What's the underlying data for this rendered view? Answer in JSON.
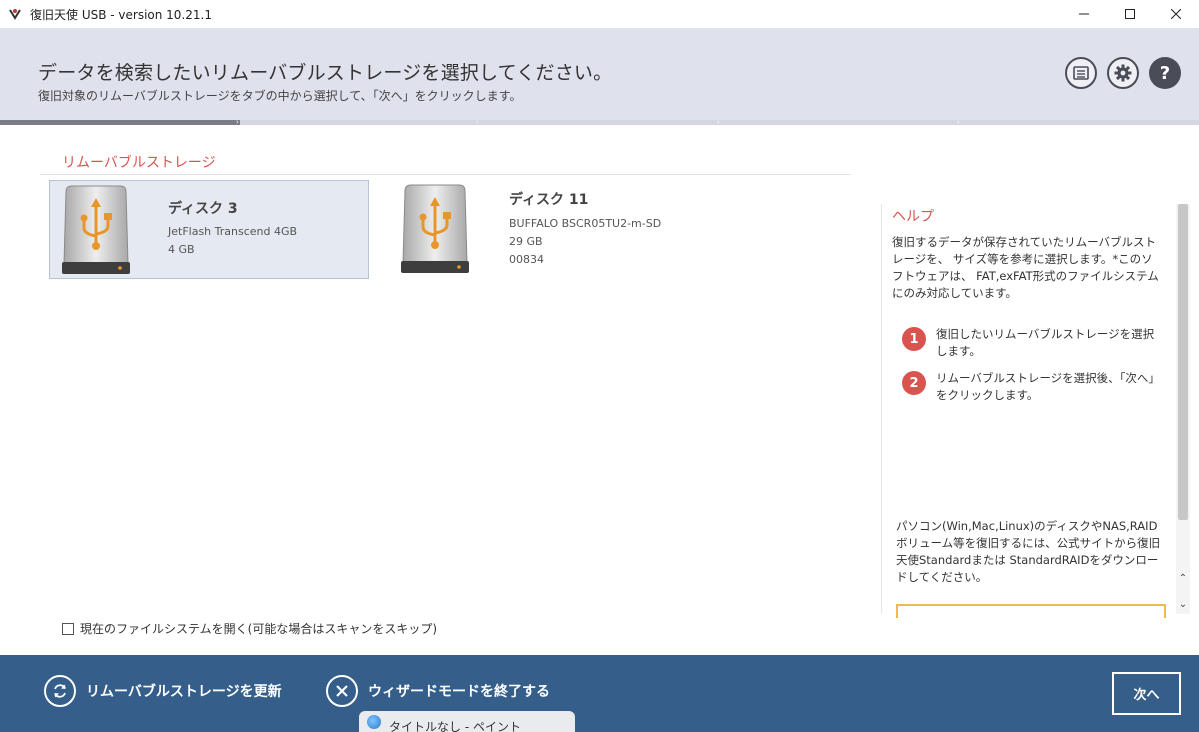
{
  "window": {
    "title": "復旧天使 USB - version 10.21.1"
  },
  "header": {
    "heading": "データを検索したいリムーバブルストレージを選択してください。",
    "subheading": "復旧対象のリムーバブルストレージをタブの中から選択して、「次へ」をクリックします。",
    "icons": [
      "log-icon",
      "gear-icon",
      "help-icon"
    ],
    "help_glyph": "?"
  },
  "progress": {
    "step": 1,
    "total_steps": 5
  },
  "storage": {
    "section_title": "リムーバブルストレージ",
    "disks": [
      {
        "name": "ディスク 3",
        "lines": [
          "JetFlash Transcend 4GB",
          "4 GB"
        ],
        "selected": true
      },
      {
        "name": "ディスク 11",
        "lines": [
          "BUFFALO BSCR05TU2-m-SD",
          "29 GB",
          "00834"
        ],
        "selected": false
      }
    ]
  },
  "options": {
    "open_fs_label": "現在のファイルシステムを開く(可能な場合はスキャンをスキップ)",
    "open_fs_checked": false
  },
  "help": {
    "title": "ヘルプ",
    "text": "復旧するデータが保存されていたリムーバブルストレージを、 サイズ等を参考に選択します。*このソフトウェアは、 FAT,exFAT形式のファイルシステムにのみ対応しています。",
    "steps": [
      {
        "num": "1",
        "text": "復旧したいリムーバブルストレージを選択します。"
      },
      {
        "num": "2",
        "text": "リムーバブルストレージを選択後、「次へ」をクリックします。"
      }
    ],
    "promo": "パソコン(Win,Mac,Linux)のディスクやNAS,RAIDボリューム等を復旧するには、公式サイトから復旧天使Standardまたは StandardRAIDをダウンロードしてください。"
  },
  "footer": {
    "refresh_label": "リムーバブルストレージを更新",
    "exit_label": "ウィザードモードを終了する",
    "next_label": "次へ"
  },
  "taskbar": {
    "thumbnail_label": "タイトルなし - ペイント"
  },
  "colors": {
    "accent_red": "#d9534f",
    "footer_blue": "#355e8a",
    "header_bg": "#dfe1ec",
    "usb_orange": "#e8962a"
  }
}
